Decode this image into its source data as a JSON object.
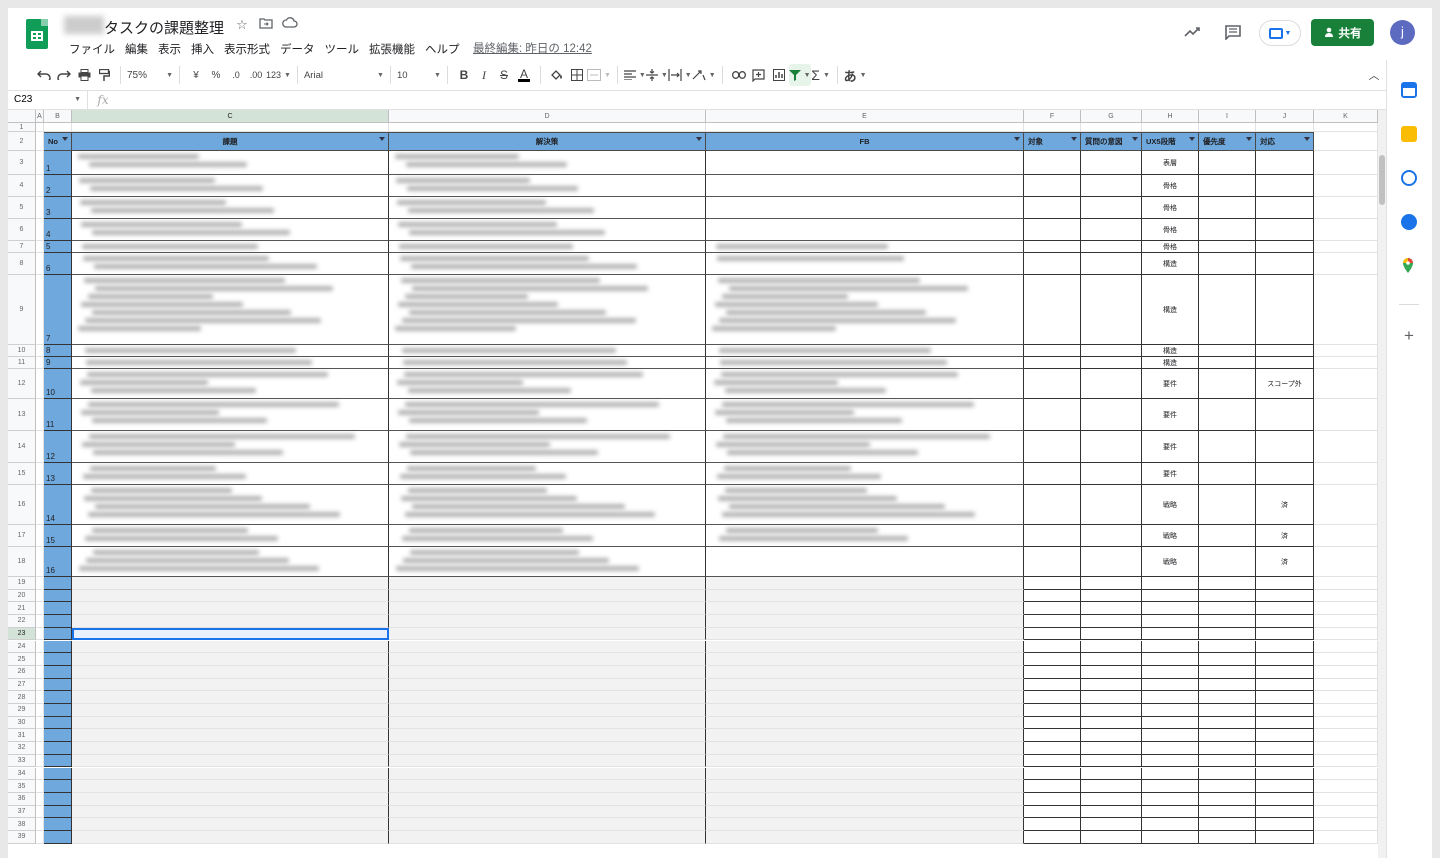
{
  "title": {
    "doc_title": "タスクの課題整理",
    "last_edit": "最終編集: 昨日の 12:42",
    "share_label": "共有",
    "avatar_letter": "j"
  },
  "menu": [
    "ファイル",
    "編集",
    "表示",
    "挿入",
    "表示形式",
    "データ",
    "ツール",
    "拡張機能",
    "ヘルプ"
  ],
  "toolbar": {
    "zoom": "75%",
    "currency": "¥",
    "percent": "%",
    "dec_decrease": ".0",
    "dec_increase": ".00",
    "number_format": "123",
    "font": "Arial",
    "font_size": "10",
    "bold": "B",
    "italic": "I",
    "strike": "S",
    "text_color": "A",
    "input_tool": "あ"
  },
  "formula_bar": {
    "name_box": "C23",
    "fx": "fx",
    "value": ""
  },
  "columns": [
    "A",
    "B",
    "C",
    "D",
    "E",
    "F",
    "G",
    "H",
    "I",
    "J",
    "K"
  ],
  "header_row": {
    "no": "No",
    "issue": "課題",
    "solution": "解決策",
    "fb": "FB",
    "target": "対象",
    "intent": "質問の意図",
    "ux5": "UX5段階",
    "priority": "優先度",
    "response": "対応"
  },
  "rows": [
    {
      "row": "3",
      "no": "1",
      "ux5": "表層",
      "response": ""
    },
    {
      "row": "4",
      "no": "2",
      "ux5": "骨格",
      "response": ""
    },
    {
      "row": "5",
      "no": "3",
      "ux5": "骨格",
      "response": ""
    },
    {
      "row": "6",
      "no": "4",
      "ux5": "骨格",
      "response": ""
    },
    {
      "row": "7",
      "no": "5",
      "ux5": "骨格",
      "response": ""
    },
    {
      "row": "8",
      "no": "6",
      "ux5": "構造",
      "response": ""
    },
    {
      "row": "9",
      "no": "7",
      "ux5": "構造",
      "response": ""
    },
    {
      "row": "10",
      "no": "8",
      "ux5": "構造",
      "response": ""
    },
    {
      "row": "11",
      "no": "9",
      "ux5": "構造",
      "response": ""
    },
    {
      "row": "12",
      "no": "10",
      "ux5": "要件",
      "response": "スコープ外"
    },
    {
      "row": "13",
      "no": "11",
      "ux5": "要件",
      "response": ""
    },
    {
      "row": "14",
      "no": "12",
      "ux5": "要件",
      "response": ""
    },
    {
      "row": "15",
      "no": "13",
      "ux5": "要件",
      "response": ""
    },
    {
      "row": "16",
      "no": "14",
      "ux5": "戦略",
      "response": "済"
    },
    {
      "row": "17",
      "no": "15",
      "ux5": "戦略",
      "response": "済"
    },
    {
      "row": "18",
      "no": "16",
      "ux5": "戦略",
      "response": "済"
    }
  ],
  "empty_rows": [
    "19",
    "20",
    "21",
    "22",
    "23",
    "24",
    "25",
    "26",
    "27",
    "28",
    "29",
    "30",
    "31",
    "32",
    "33",
    "34",
    "35",
    "36",
    "37",
    "38",
    "39"
  ],
  "colors": {
    "header_blue": "#6fa8dc",
    "share_green": "#188038",
    "sheets_green": "#0f9d58",
    "accent_blue": "#1a73e8"
  }
}
